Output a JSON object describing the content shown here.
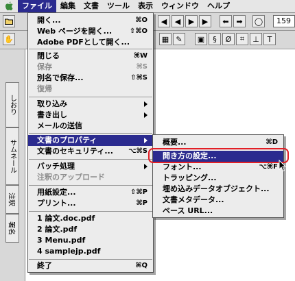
{
  "menubar": {
    "apple_icon": "apple-logo-icon",
    "items": [
      {
        "label": "ファイル",
        "active": true
      },
      {
        "label": "編集"
      },
      {
        "label": "文書"
      },
      {
        "label": "ツール"
      },
      {
        "label": "表示"
      },
      {
        "label": "ウィンドウ"
      },
      {
        "label": "ヘルプ"
      }
    ]
  },
  "toolbar": {
    "zoom_value": "159",
    "icons": [
      "open-folder-icon",
      "print-icon",
      "hand-tool-icon",
      "previous-page-icon",
      "next-page-icon",
      "back-icon",
      "forward-icon",
      "text-select-icon",
      "attach-icon",
      "crop-icon",
      "text-tool-icon"
    ]
  },
  "side_tabs": [
    {
      "label": "しおり"
    },
    {
      "label": "サムネール"
    },
    {
      "label": "注釈"
    },
    {
      "label": "署名"
    }
  ],
  "file_menu": {
    "items": [
      {
        "label": "開く...",
        "shortcut": "⌘O"
      },
      {
        "label": "Web ページを開く...",
        "shortcut": "⇧⌘O"
      },
      {
        "label": "Adobe PDFとして開く..."
      },
      {
        "label": "閉じる",
        "shortcut": "⌘W"
      },
      {
        "label": "保存",
        "shortcut": "⌘S",
        "disabled": true
      },
      {
        "label": "別名で保存...",
        "shortcut": "⇧⌘S"
      },
      {
        "label": "復帰",
        "disabled": true
      },
      {
        "label": "取り込み",
        "submenu": true
      },
      {
        "label": "書き出し",
        "submenu": true
      },
      {
        "label": "メールの送信"
      },
      {
        "label": "文書のプロパティ",
        "submenu": true,
        "highlighted": true
      },
      {
        "label": "文書のセキュリティ...",
        "shortcut": "⌥⌘S"
      },
      {
        "label": "バッチ処理",
        "submenu": true
      },
      {
        "label": "注釈のアップロード",
        "disabled": true
      },
      {
        "label": "用紙設定...",
        "shortcut": "⇧⌘P"
      },
      {
        "label": "プリント...",
        "shortcut": "⌘P"
      },
      {
        "label": "1 論文.doc.pdf"
      },
      {
        "label": "2 論文.pdf"
      },
      {
        "label": "3 Menu.pdf"
      },
      {
        "label": "4 samplejp.pdf"
      },
      {
        "label": "終了",
        "shortcut": "⌘Q"
      }
    ]
  },
  "properties_submenu": {
    "items": [
      {
        "label": "概要...",
        "shortcut": "⌘D"
      },
      {
        "label": "開き方の設定...",
        "highlighted": true
      },
      {
        "label": "フォント...",
        "shortcut": "⌥⌘F"
      },
      {
        "label": "トラッピング..."
      },
      {
        "label": "埋め込みデータオブジェクト..."
      },
      {
        "label": "文書メタデータ..."
      },
      {
        "label": "ベース URL..."
      }
    ]
  },
  "colors": {
    "highlight": "#2b2b8f",
    "callout": "#e21f26",
    "disabled": "#8d8d8d"
  }
}
